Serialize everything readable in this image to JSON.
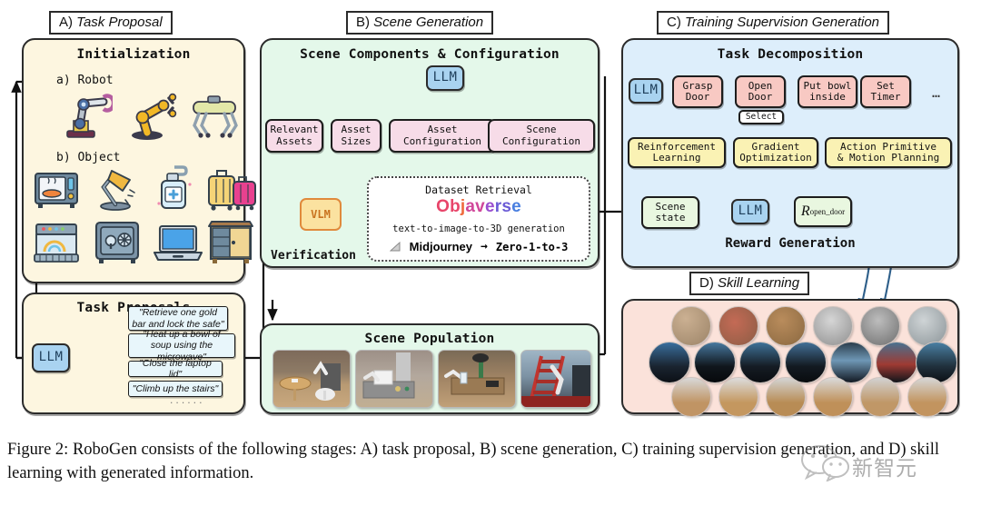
{
  "figure": {
    "caption": "Figure 2:  RoboGen consists of the following stages: A) task proposal, B) scene generation, C) training supervision generation, and D) skill learning with generated information.",
    "watermark_text": "新智元"
  },
  "colors": {
    "panel_cream": "#fdf6e0",
    "panel_green": "#e4f8ea",
    "panel_blue": "#ddeefb",
    "panel_pink": "#fbe2da",
    "llm_blue": "#a9d3f0",
    "node_pink": "#f7dce8",
    "node_salmon": "#f8c9c3",
    "node_yellow": "#faf2b4",
    "node_mint": "#e9f7e0",
    "arrow_blue": "#2e5f8a",
    "arrow_black": "#1a1a1a",
    "vlm_orange": "#e08a3c"
  },
  "sections": {
    "a": {
      "plate_prefix": "A)",
      "plate_title": "Task Proposal"
    },
    "b": {
      "plate_prefix": "B)",
      "plate_title": "Scene Generation"
    },
    "c": {
      "plate_prefix": "C)",
      "plate_title": "Training Supervision Generation"
    },
    "d": {
      "plate_prefix": "D)",
      "plate_title": "Skill Learning"
    }
  },
  "initialization": {
    "title": "Initialization",
    "robot_label": "a) Robot",
    "object_label": "b) Object",
    "robot_icons": [
      "articulated-arm-robot-icon",
      "yellow-industrial-arm-icon",
      "quadruped-robot-icon"
    ],
    "object_icons": [
      "microwave-icon",
      "desk-lamp-icon",
      "soap-dispenser-icon",
      "luggage-icon",
      "dishwasher-icon",
      "safe-icon",
      "laptop-icon",
      "cabinet-icon"
    ]
  },
  "task_proposals": {
    "title": "Task Proposals",
    "llm_label": "LLM",
    "items": [
      "\"Retrieve one gold bar and lock the safe\"",
      "\"Heat up a bowl of soup using the microwave\"",
      "\"Close the laptop lid\"",
      "\"Climb up the stairs\""
    ],
    "ellipsis": "......"
  },
  "scene_components": {
    "title": "Scene Components & Configuration",
    "llm_label": "LLM",
    "nodes": [
      "Relevant\nAssets",
      "Asset\nSizes",
      "Asset\nConfiguration",
      "Scene\nConfiguration"
    ],
    "node_labels": [
      {
        "l1": "Relevant",
        "l2": "Assets"
      },
      {
        "l1": "Asset",
        "l2": "Sizes"
      },
      {
        "l1": "Asset",
        "l2": "Configuration"
      },
      {
        "l1": "Scene",
        "l2": "Configuration"
      }
    ],
    "vlm_label": "VLM",
    "verification_label": "Verification",
    "dataset": {
      "title": "Dataset Retrieval",
      "brand": "Objaverse",
      "subtitle": "text-to-image-to-3D generation",
      "tool_left": "Midjourney",
      "arrow": "→",
      "tool_right": "Zero-1-to-3"
    }
  },
  "scene_population": {
    "title": "Scene Population",
    "thumbs": [
      "living-room-table-robot-scene",
      "kitchen-counter-robot-scene",
      "desk-laptop-robot-scene",
      "red-staircase-robot-scene"
    ]
  },
  "task_decomposition": {
    "title": "Task Decomposition",
    "llm_label": "LLM",
    "steps": [
      {
        "l1": "Grasp",
        "l2": "Door"
      },
      {
        "l1": "Open",
        "l2": "Door"
      },
      {
        "l1": "Put bowl",
        "l2": "inside"
      },
      {
        "l1": "Set",
        "l2": "Timer"
      }
    ],
    "more": "…",
    "select_label": "Select",
    "methods": [
      {
        "l1": "Reinforcement",
        "l2": "Learning"
      },
      {
        "l1": "Gradient",
        "l2": "Optimization"
      },
      {
        "l1": "Action Primitive",
        "l2": "& Motion Planning"
      }
    ]
  },
  "reward_generation": {
    "title": "Reward Generation",
    "scene_state": {
      "l1": "Scene",
      "l2": "state"
    },
    "llm_label": "LLM",
    "reward_base": "R",
    "reward_sub": "open_door"
  },
  "skill_learning": {
    "rows": [
      [
        "skill-clip-1",
        "skill-clip-2",
        "skill-clip-3",
        "skill-clip-4",
        "skill-clip-5",
        "skill-clip-6"
      ],
      [
        "skill-clip-7",
        "skill-clip-8",
        "skill-clip-9",
        "skill-clip-10",
        "skill-clip-11",
        "skill-clip-12",
        "skill-clip-13"
      ],
      [
        "skill-clip-14",
        "skill-clip-15",
        "skill-clip-16",
        "skill-clip-17",
        "skill-clip-18",
        "skill-clip-19"
      ]
    ]
  }
}
